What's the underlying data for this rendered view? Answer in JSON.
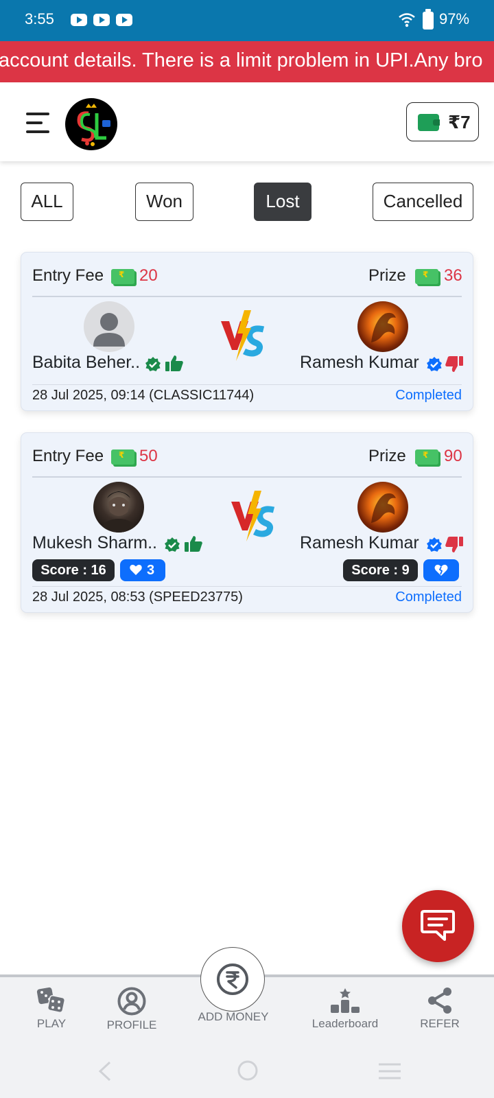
{
  "status_bar": {
    "time": "3:55",
    "battery": "97%"
  },
  "marquee": {
    "text": "account details. There is a limit problem in UPI.Any bro"
  },
  "header": {
    "wallet_amount": "₹7"
  },
  "filters": [
    "ALL",
    "Won",
    "Lost",
    "Cancelled"
  ],
  "active_filter": "Lost",
  "matches": [
    {
      "entry_label": "Entry Fee",
      "entry_fee": "20",
      "prize_label": "Prize",
      "prize": "36",
      "player1": {
        "name": "Babita Beher.."
      },
      "player2": {
        "name": "Ramesh Kumar"
      },
      "date": "28 Jul 2025, 09:14 (CLASSIC11744)",
      "status": "Completed"
    },
    {
      "entry_label": "Entry Fee",
      "entry_fee": "50",
      "prize_label": "Prize",
      "prize": "90",
      "player1": {
        "name": "Mukesh Sharm..",
        "score": "Score : 16",
        "hearts": "3"
      },
      "player2": {
        "name": "Ramesh Kumar",
        "score": "Score : 9"
      },
      "date": "28 Jul 2025, 08:53 (SPEED23775)",
      "status": "Completed"
    }
  ],
  "bottom_nav": {
    "play": "PLAY",
    "profile": "PROFILE",
    "add_money": "ADD MONEY",
    "leaderboard": "Leaderboard",
    "refer": "REFER"
  },
  "colors": {
    "status_bar": "#0a77ad",
    "marquee": "#dc3545",
    "amount": "#dc3545",
    "link": "#0d6efd",
    "fab": "#c82323",
    "verified_green": "#1a8a4a",
    "verified_blue": "#0d6efd"
  }
}
